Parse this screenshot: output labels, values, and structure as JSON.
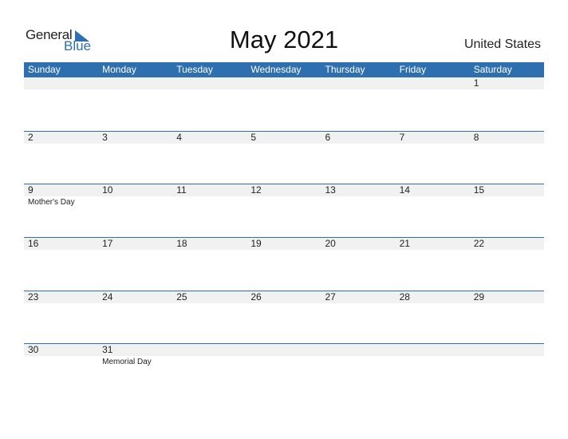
{
  "logo": {
    "general": "General",
    "blue": "Blue"
  },
  "title": "May 2021",
  "country": "United States",
  "colors": {
    "accent": "#2e6fb0",
    "band": "#f1f1f1"
  },
  "weekdays": [
    "Sunday",
    "Monday",
    "Tuesday",
    "Wednesday",
    "Thursday",
    "Friday",
    "Saturday"
  ],
  "weeks": [
    [
      {
        "d": ""
      },
      {
        "d": ""
      },
      {
        "d": ""
      },
      {
        "d": ""
      },
      {
        "d": ""
      },
      {
        "d": ""
      },
      {
        "d": "1"
      }
    ],
    [
      {
        "d": "2"
      },
      {
        "d": "3"
      },
      {
        "d": "4"
      },
      {
        "d": "5"
      },
      {
        "d": "6"
      },
      {
        "d": "7"
      },
      {
        "d": "8"
      }
    ],
    [
      {
        "d": "9",
        "e": "Mother's Day"
      },
      {
        "d": "10"
      },
      {
        "d": "11"
      },
      {
        "d": "12"
      },
      {
        "d": "13"
      },
      {
        "d": "14"
      },
      {
        "d": "15"
      }
    ],
    [
      {
        "d": "16"
      },
      {
        "d": "17"
      },
      {
        "d": "18"
      },
      {
        "d": "19"
      },
      {
        "d": "20"
      },
      {
        "d": "21"
      },
      {
        "d": "22"
      }
    ],
    [
      {
        "d": "23"
      },
      {
        "d": "24"
      },
      {
        "d": "25"
      },
      {
        "d": "26"
      },
      {
        "d": "27"
      },
      {
        "d": "28"
      },
      {
        "d": "29"
      }
    ],
    [
      {
        "d": "30"
      },
      {
        "d": "31",
        "e": "Memorial Day"
      },
      {
        "d": ""
      },
      {
        "d": ""
      },
      {
        "d": ""
      },
      {
        "d": ""
      },
      {
        "d": ""
      }
    ]
  ]
}
